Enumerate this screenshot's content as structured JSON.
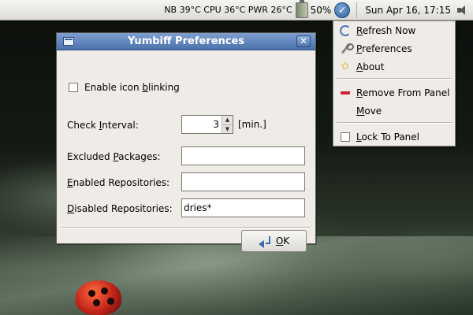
{
  "panel": {
    "sensors": "NB 39°C CPU 36°C PWR 26°C",
    "battery": "50%",
    "clock": "Sun Apr 16, 17:15"
  },
  "dialog": {
    "title": "Yumbiff Preferences",
    "blink_label_pre": "Enable icon ",
    "blink_label_key": "b",
    "blink_label_post": "linking",
    "check_interval_pre": "Check ",
    "check_interval_key": "I",
    "check_interval_post": "nterval:",
    "check_interval_value": "3",
    "check_interval_unit": "[min.]",
    "excluded_pre": "Excluded ",
    "excluded_key": "P",
    "excluded_post": "ackages:",
    "excluded_value": "",
    "enabled_key": "E",
    "enabled_post": "nabled Repositories:",
    "enabled_value": "",
    "disabled_key": "D",
    "disabled_post": "isabled Repositories:",
    "disabled_value": "dries*",
    "ok_key": "O",
    "ok_post": "K"
  },
  "menu": {
    "items": [
      {
        "key": "R",
        "rest": "efresh Now",
        "icon": "refresh-icon"
      },
      {
        "key": "P",
        "rest": "references",
        "icon": "preferences-icon"
      },
      {
        "key": "A",
        "rest": "bout",
        "icon": "about-icon"
      },
      {
        "key": "R",
        "rest": "emove From Panel",
        "icon": "remove-icon"
      },
      {
        "key": "M",
        "rest": "ove",
        "icon": ""
      },
      {
        "key": "L",
        "rest": "ock To Panel",
        "icon": "checkbox"
      }
    ]
  }
}
